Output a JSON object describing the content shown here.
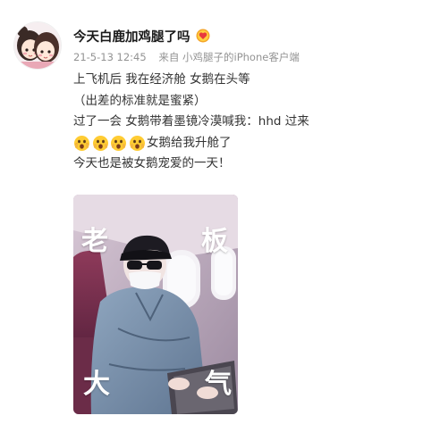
{
  "post": {
    "username": "今天白鹿加鸡腿了吗",
    "time": "21-5-13 12:45",
    "source_prefix": "来自",
    "source_device": "小鸡腿子的iPhone客户端",
    "text_lines": [
      "上飞机后 我在经济舱 女鹅在头等",
      "（出差的标准就是蜜紧）",
      "过了一会 女鹅带着墨镜冷漠喊我：hhd 过来",
      "女鹅给我升舱了",
      "今天也是被女鹅宠爱的一天！"
    ],
    "photo": {
      "top_left": "老",
      "top_right": "板",
      "bottom_left": "大",
      "bottom_right": "气"
    }
  },
  "icons": {
    "vip": "yellow-heart-badge-icon",
    "emoji": "scared-face-emoji-icon"
  },
  "colors": {
    "meta_gray": "#939393",
    "text": "#333333",
    "username": "#1a1a1a",
    "badge_orange": "#f4a52a"
  }
}
